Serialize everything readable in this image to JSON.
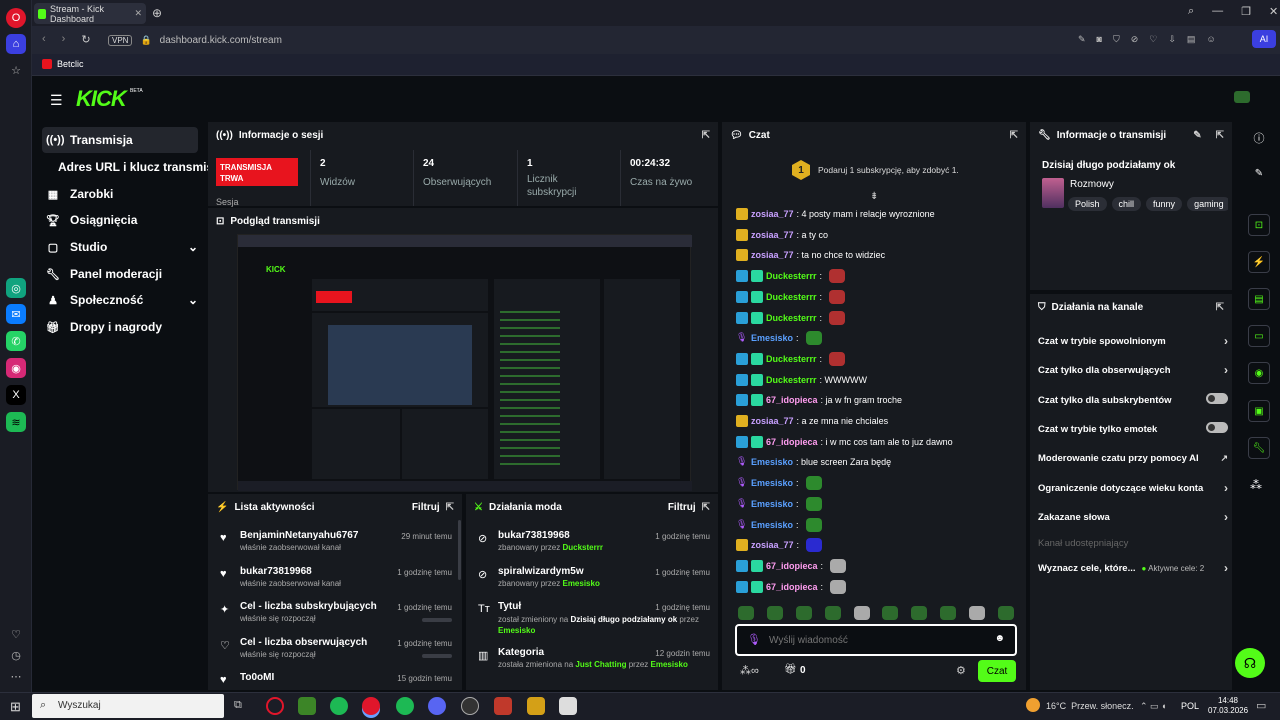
{
  "browser": {
    "tab_title": "Stream - Kick Dashboard",
    "url_badge": "VPN",
    "url": "dashboard.kick.com/stream",
    "bookmark": "Betclic",
    "ai_label": "AI"
  },
  "kick": {
    "logo": "KICK",
    "logo_beta": "BETA"
  },
  "nav": {
    "items": [
      {
        "label": "Transmisja",
        "icon": "broadcast-icon"
      },
      {
        "label": "Adres URL i klucz transmisji",
        "icon": ""
      },
      {
        "label": "Zarobki",
        "icon": "earnings-icon"
      },
      {
        "label": "Osiągnięcia",
        "icon": "trophy-icon"
      },
      {
        "label": "Studio",
        "icon": "studio-icon"
      },
      {
        "label": "Panel moderacji",
        "icon": "wrench-icon"
      },
      {
        "label": "Społeczność",
        "icon": "community-icon"
      },
      {
        "label": "Dropy i nagrody",
        "icon": "gift-icon"
      }
    ]
  },
  "session": {
    "title": "Informacje o sesji",
    "status": "TRANSMISJA TRWA",
    "status_label": "Sesja",
    "stats": [
      {
        "value": "2",
        "label": "Widzów"
      },
      {
        "value": "24",
        "label": "Obserwujących"
      },
      {
        "value": "1",
        "label": "Licznik subskrypcji"
      },
      {
        "value": "00:24:32",
        "label": "Czas na żywo"
      }
    ]
  },
  "preview": {
    "title": "Podgląd transmisji"
  },
  "activity": {
    "title": "Lista aktywności",
    "filter": "Filtruj",
    "items": [
      {
        "name": "BenjaminNetanyahu6767",
        "sub": "właśnie zaobserwował kanał",
        "time": "29 minut temu"
      },
      {
        "name": "bukar73819968",
        "sub": "właśnie zaobserwował kanał",
        "time": "1 godzinę temu"
      },
      {
        "name": "Cel - liczba subskrybujących",
        "sub": "właśnie się rozpoczął",
        "time": "1 godzinę temu"
      },
      {
        "name": "Cel - liczba obserwujących",
        "sub": "właśnie się rozpoczął",
        "time": "1 godzinę temu"
      },
      {
        "name": "To0oMI",
        "sub": "",
        "time": "15 godzin temu"
      }
    ]
  },
  "modactions": {
    "title": "Działania moda",
    "filter": "Filtruj",
    "items": [
      {
        "name": "bukar73819968",
        "sub_pre": "zbanowany przez ",
        "sub_by": "Ducksterrr",
        "sub_mid": "",
        "sub_bold": "",
        "time": "1 godzinę temu"
      },
      {
        "name": "spiralwizardym5w",
        "sub_pre": "zbanowany przez ",
        "sub_by": "Emesisko",
        "sub_mid": "",
        "sub_bold": "",
        "time": "1 godzinę temu"
      },
      {
        "name": "Tytuł",
        "sub_pre": "został zmieniony na ",
        "sub_bold": "Dzisiaj długo podziałamy ok",
        "sub_mid": " przez ",
        "sub_by": "Emesisko",
        "time": "1 godzinę temu"
      },
      {
        "name": "Kategoria",
        "sub_pre": "została zmieniona na ",
        "sub_bold": "Just Chatting",
        "sub_mid": " przez ",
        "sub_by": "Emesisko",
        "time": "12 godzin temu"
      }
    ]
  },
  "chat": {
    "title": "Czat",
    "sub_goal": "Podaruj 1 subskrypcję, aby zdobyć 1.",
    "sub_goal_num": "1",
    "messages": [
      {
        "user": "zosiaa_77",
        "text": ": 4 posty mam i relacje wyroznione",
        "color": "#c8a0ff"
      },
      {
        "user": "zosiaa_77",
        "text": ": a ty co",
        "color": "#c8a0ff"
      },
      {
        "user": "zosiaa_77",
        "text": ": ta no chce to widziec",
        "color": "#c8a0ff"
      },
      {
        "user": "Duckesterrr",
        "text": ":",
        "color": "#53fc18"
      },
      {
        "user": "Duckesterrr",
        "text": ":",
        "color": "#53fc18"
      },
      {
        "user": "Duckesterrr",
        "text": ":",
        "color": "#53fc18"
      },
      {
        "user": "Emesisko",
        "text": ":",
        "color": "#5aa0ff"
      },
      {
        "user": "Duckesterrr",
        "text": ":",
        "color": "#53fc18"
      },
      {
        "user": "Duckesterrr",
        "text": ": WWWWW",
        "color": "#53fc18"
      },
      {
        "user": "67_idopieca",
        "text": ": ja w fn gram troche",
        "color": "#ff9df0"
      },
      {
        "user": "zosiaa_77",
        "text": ": a ze mna nie chciales",
        "color": "#c8a0ff"
      },
      {
        "user": "67_idopieca",
        "text": ": i w mc cos tam ale to juz dawno",
        "color": "#ff9df0"
      },
      {
        "user": "Emesisko",
        "text": ": blue screen Zara będę",
        "color": "#5aa0ff"
      },
      {
        "user": "Emesisko",
        "text": ":",
        "color": "#5aa0ff"
      },
      {
        "user": "Emesisko",
        "text": ":",
        "color": "#5aa0ff"
      },
      {
        "user": "Emesisko",
        "text": ":",
        "color": "#5aa0ff"
      },
      {
        "user": "zosiaa_77",
        "text": ":",
        "color": "#c8a0ff"
      },
      {
        "user": "67_idopieca",
        "text": ":",
        "color": "#ff9df0"
      },
      {
        "user": "67_idopieca",
        "text": ":",
        "color": "#ff9df0"
      }
    ],
    "placeholder": "Wyślij wiadomość",
    "points": "0",
    "send": "Czat"
  },
  "stream_info": {
    "title": "Informacje o transmisji",
    "stream_title": "Dzisiaj długo podziałamy ok",
    "category": "Rozmowy",
    "tags": [
      "Polish",
      "chill",
      "funny",
      "gaming"
    ]
  },
  "channel_actions": {
    "title": "Działania na kanale",
    "items": [
      {
        "label": "Czat w trybie spowolnionym",
        "kind": "arrow"
      },
      {
        "label": "Czat tylko dla obserwujących",
        "kind": "arrow"
      },
      {
        "label": "Czat tylko dla subskrybentów",
        "kind": "toggle"
      },
      {
        "label": "Czat w trybie tylko emotek",
        "kind": "toggle"
      },
      {
        "label": "Moderowanie czatu przy pomocy AI",
        "kind": "link"
      },
      {
        "label": "Ograniczenie dotyczące wieku konta",
        "kind": "arrow"
      },
      {
        "label": "Zakazane słowa",
        "kind": "arrow"
      }
    ],
    "shared": "Kanał udostępniający",
    "goals_label": "Wyznacz cele, które...",
    "goals_active": "Aktywne cele: 2"
  },
  "taskbar": {
    "search": "Wyszukaj",
    "weather": "16°C  Przew. słonecz.",
    "lang": "POL",
    "time": "14:48",
    "date": "07.03.2026"
  },
  "colors": {
    "accent": "#53fc18",
    "live": "#e8141e",
    "panel": "#171a1f"
  }
}
